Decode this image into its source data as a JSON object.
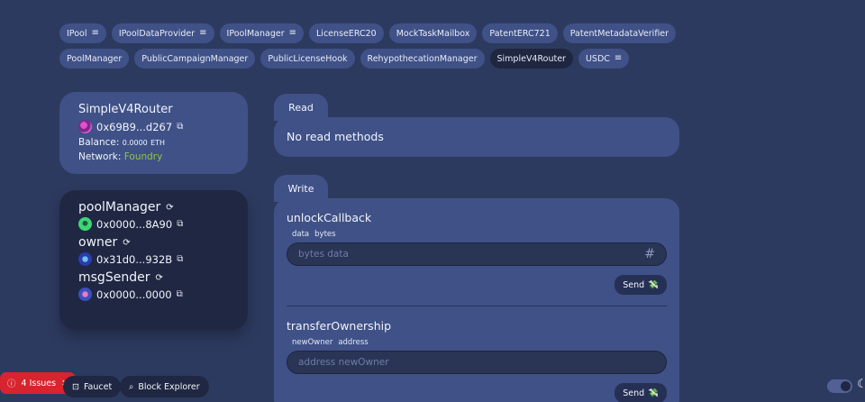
{
  "tabs": [
    {
      "label": "IPool",
      "icon": "list-add-icon",
      "active": false,
      "has_icon": true
    },
    {
      "label": "IPoolDataProvider",
      "icon": "list-add-icon",
      "active": false,
      "has_icon": true
    },
    {
      "label": "IPoolManager",
      "icon": "list-add-icon",
      "active": false,
      "has_icon": true
    },
    {
      "label": "LicenseERC20",
      "active": false,
      "has_icon": false
    },
    {
      "label": "MockTaskMailbox",
      "active": false,
      "has_icon": false
    },
    {
      "label": "PatentERC721",
      "active": false,
      "has_icon": false
    },
    {
      "label": "PatentMetadataVerifier",
      "active": false,
      "has_icon": false
    },
    {
      "label": "PoolManager",
      "active": false,
      "has_icon": false
    },
    {
      "label": "PublicCampaignManager",
      "active": false,
      "has_icon": false
    },
    {
      "label": "PublicLicenseHook",
      "active": false,
      "has_icon": false
    },
    {
      "label": "RehypothecationManager",
      "active": false,
      "has_icon": false
    },
    {
      "label": "SimpleV4Router",
      "active": true,
      "has_icon": false
    },
    {
      "label": "USDC",
      "icon": "list-add-icon",
      "active": false,
      "has_icon": true
    }
  ],
  "contract": {
    "name": "SimpleV4Router",
    "address": "0x69B9...d267",
    "balance_label": "Balance:",
    "balance_value": "0.0000",
    "balance_unit": "ETH",
    "network_label": "Network:",
    "network_value": "Foundry"
  },
  "variables": [
    {
      "name": "poolManager",
      "address": "0x0000...8A90"
    },
    {
      "name": "owner",
      "address": "0x31d0...932B"
    },
    {
      "name": "msgSender",
      "address": "0x0000...0000"
    }
  ],
  "read": {
    "tab_label": "Read",
    "empty_text": "No read methods"
  },
  "write": {
    "tab_label": "Write",
    "methods": [
      {
        "name": "unlockCallback",
        "param_name": "data",
        "param_type": "bytes",
        "placeholder": "bytes data",
        "show_hash": true,
        "send_label": "Send"
      },
      {
        "name": "transferOwnership",
        "param_name": "newOwner",
        "param_type": "address",
        "placeholder": "address newOwner",
        "show_hash": false,
        "send_label": "Send"
      }
    ]
  },
  "footer": {
    "issues_label": "4 Issues",
    "faucet_label": "Faucet",
    "explorer_label": "Block Explorer"
  },
  "colors": {
    "accent_green": "#8fc44a",
    "issues_red": "#d7242e"
  }
}
